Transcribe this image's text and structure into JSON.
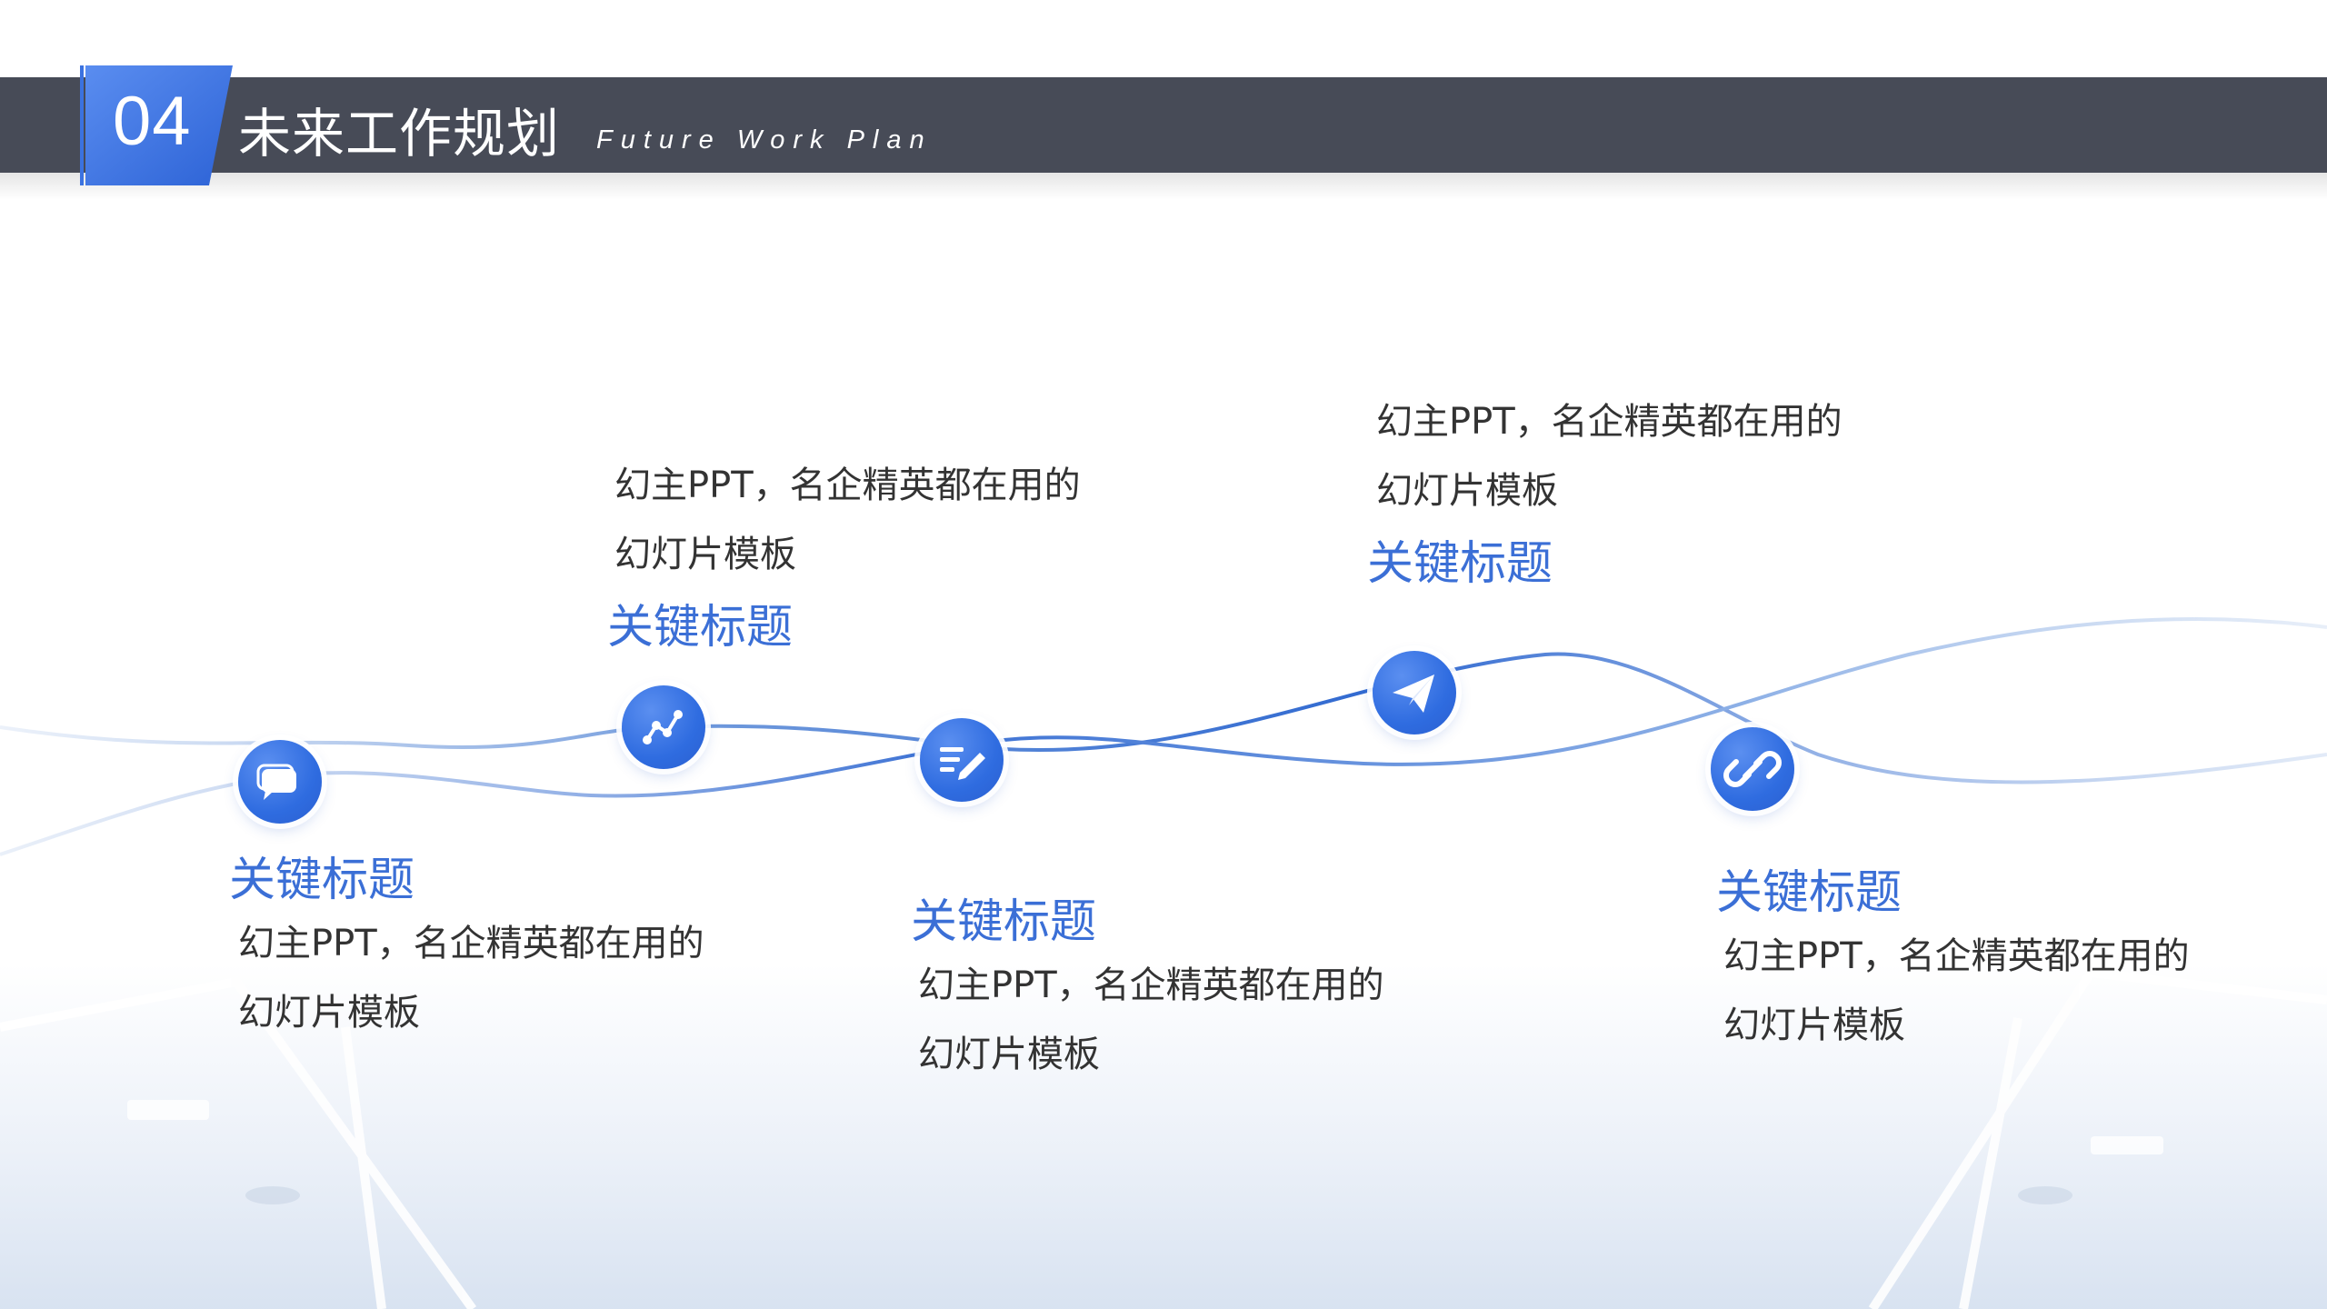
{
  "header": {
    "number": "04",
    "title": "未来工作规划",
    "subtitle": "Future Work Plan"
  },
  "items": [
    {
      "heading": "关键标题",
      "line1": "幻主PPT，名企精英都在用的",
      "line2": "幻灯片模板",
      "icon": "chat-bubble-icon"
    },
    {
      "heading": "关键标题",
      "line1": "幻主PPT，名企精英都在用的",
      "line2": "幻灯片模板",
      "icon": "line-chart-icon"
    },
    {
      "heading": "关键标题",
      "line1": "幻主PPT，名企精英都在用的",
      "line2": "幻灯片模板",
      "icon": "edit-list-icon"
    },
    {
      "heading": "关键标题",
      "line1": "幻主PPT，名企精英都在用的",
      "line2": "幻灯片模板",
      "icon": "paper-plane-icon"
    },
    {
      "heading": "关键标题",
      "line1": "幻主PPT，名企精英都在用的",
      "line2": "幻灯片模板",
      "icon": "link-icon"
    }
  ],
  "colors": {
    "header_bar": "#474b57",
    "accent_blue": "#2f6ce0",
    "heading_blue": "#3b6fd6"
  }
}
